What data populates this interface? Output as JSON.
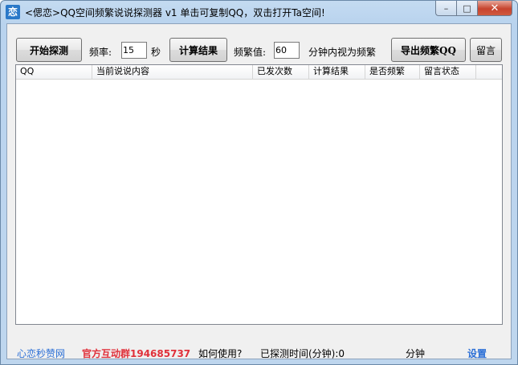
{
  "window": {
    "icon_glyph": "恋",
    "title": "<偲恋>QQ空间频繁说说探测器 v1   单击可复制QQ，双击打开Ta空间!",
    "controls": {
      "minimize": "–",
      "maximize": "□",
      "close": "✕"
    }
  },
  "toolbar": {
    "start_label": "开始探测",
    "freq_label": "频率:",
    "freq_value": "15",
    "sec_label": "秒",
    "calc_label": "计算结果",
    "threshold_label": "频繁值:",
    "threshold_value": "60",
    "threshold_note": "分钟内视为频繁",
    "export_label": "导出频繁QQ",
    "message_label": "留言"
  },
  "table": {
    "columns": [
      "QQ",
      "当前说说内容",
      "已发次数",
      "计算结果",
      "是否频繁",
      "留言状态"
    ],
    "rows": []
  },
  "statusbar": {
    "link": "心恋秒赞网",
    "group": "官方互动群194685737",
    "howto": "如何使用?",
    "elapsed": "已探测时间(分钟):0",
    "unit": "分钟",
    "settings": "设置"
  },
  "colors": {
    "link": "#2b6fd6",
    "group": "#e0303a",
    "titlebar": "#c4dbf1"
  }
}
